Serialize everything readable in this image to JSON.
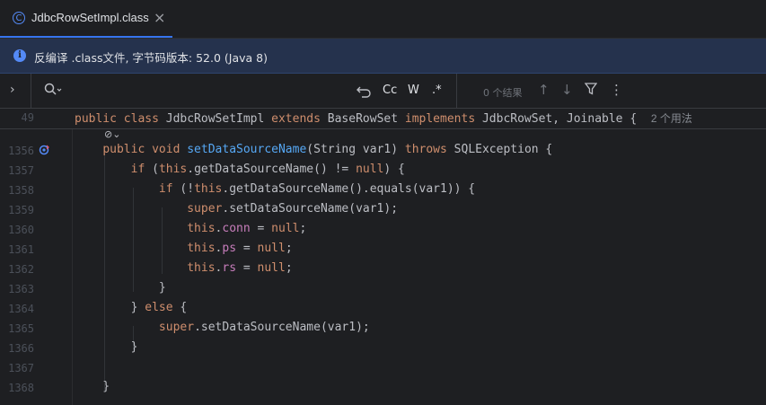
{
  "tab": {
    "title": "JdbcRowSetImpl.class",
    "icon": "class-icon",
    "close": "×"
  },
  "banner": {
    "text": "反编译 .class文件, 字节码版本: 52.0 (Java 8)"
  },
  "findbar": {
    "expand": "›",
    "search_icon": "search-icon",
    "regex_toggle": ".*",
    "case_toggle": "Cc",
    "word_toggle": "W",
    "results": "0 个结果"
  },
  "editor": {
    "sticky": {
      "line": "49",
      "code": "public class JdbcRowSetImpl extends BaseRowSet implements JdbcRowSet, Joinable {",
      "hint": "2 个用法"
    },
    "lines": [
      {
        "n": "1356",
        "code": "    public void setDataSourceName(String var1) throws SQLException {"
      },
      {
        "n": "1357",
        "code": "        if (this.getDataSourceName() != null) {"
      },
      {
        "n": "1358",
        "code": "            if (!this.getDataSourceName().equals(var1)) {"
      },
      {
        "n": "1359",
        "code": "                super.setDataSourceName(var1);"
      },
      {
        "n": "1360",
        "code": "                this.conn = null;"
      },
      {
        "n": "1361",
        "code": "                this.ps = null;"
      },
      {
        "n": "1362",
        "code": "                this.rs = null;"
      },
      {
        "n": "1363",
        "code": "            }"
      },
      {
        "n": "1364",
        "code": "        } else {"
      },
      {
        "n": "1365",
        "code": "            super.setDataSourceName(var1);"
      },
      {
        "n": "1366",
        "code": "        }"
      },
      {
        "n": "1367",
        "code": ""
      },
      {
        "n": "1368",
        "code": "    }"
      }
    ]
  },
  "colors": {
    "accent": "#3574f0",
    "banner_bg": "#25324d",
    "keyword": "#cf8e6d",
    "method": "#56a8f5",
    "field": "#c77dbb"
  }
}
